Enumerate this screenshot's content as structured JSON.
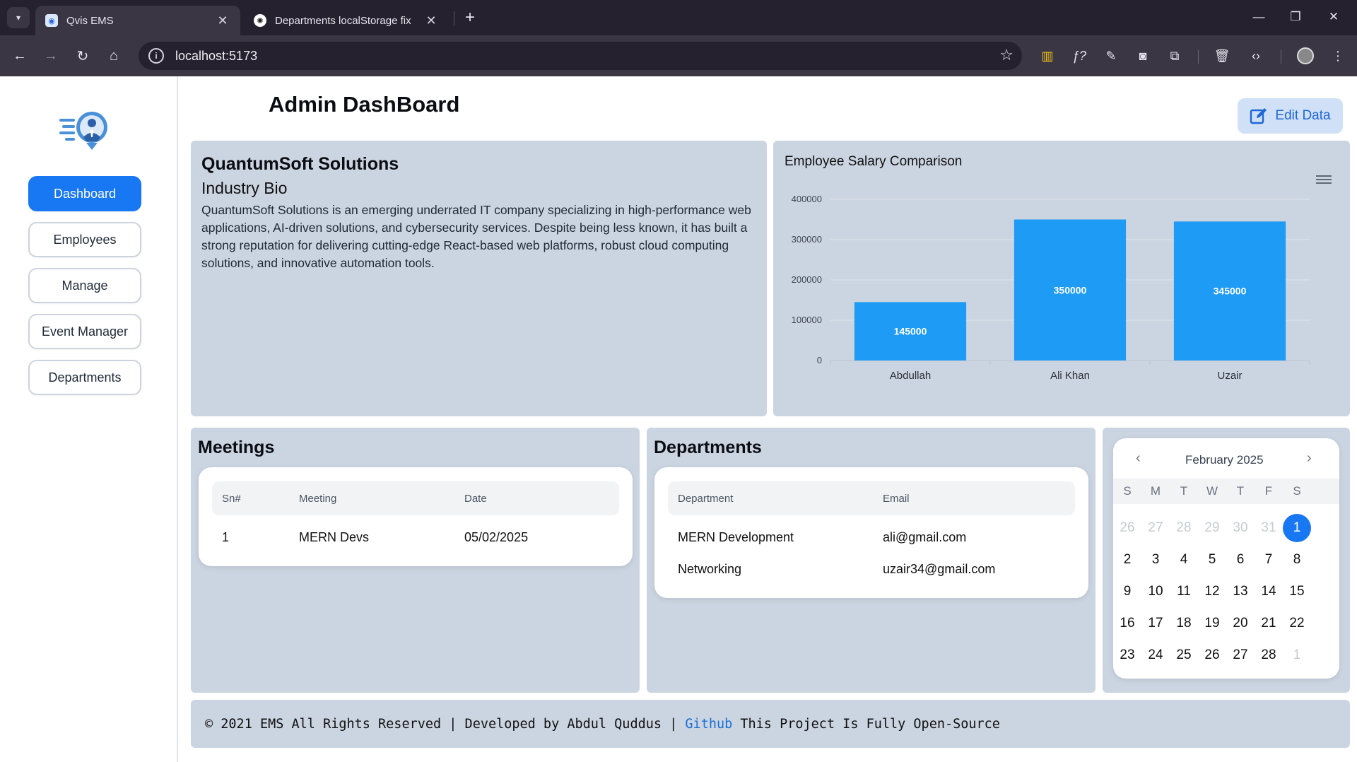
{
  "browser": {
    "tabs": [
      {
        "title": "Qvis EMS",
        "active": true
      },
      {
        "title": "Departments localStorage fix",
        "active": false
      }
    ],
    "url": "localhost:5173"
  },
  "sidebar": {
    "items": [
      {
        "label": "Dashboard",
        "active": true
      },
      {
        "label": "Employees"
      },
      {
        "label": "Manage"
      },
      {
        "label": "Event Manager"
      },
      {
        "label": "Departments"
      }
    ]
  },
  "header": {
    "title": "Admin DashBoard",
    "edit_label": "Edit Data"
  },
  "company": {
    "name": "QuantumSoft Solutions",
    "bio_title": "Industry Bio",
    "bio_text": "QuantumSoft Solutions is an emerging underrated IT company specializing in high-performance web applications, AI-driven solutions, and cybersecurity services. Despite being less known, it has built a strong reputation for delivering cutting-edge React-based web platforms, robust cloud computing solutions, and innovative automation tools."
  },
  "chart_data": {
    "type": "bar",
    "title": "Employee Salary Comparison",
    "categories": [
      "Abdullah",
      "Ali Khan",
      "Uzair"
    ],
    "values": [
      145000,
      350000,
      345000
    ],
    "yticks": [
      "0",
      "100000",
      "200000",
      "300000",
      "400000"
    ],
    "ylim": [
      0,
      400000
    ],
    "bar_color": "#1e9bf5",
    "grid": true
  },
  "meetings": {
    "title": "Meetings",
    "columns": [
      "Sn#",
      "Meeting",
      "Date"
    ],
    "rows": [
      [
        "1",
        "MERN Devs",
        "05/02/2025"
      ]
    ]
  },
  "departments": {
    "title": "Departments",
    "columns": [
      "Department",
      "Email"
    ],
    "rows": [
      [
        "MERN Development",
        "ali@gmail.com"
      ],
      [
        "Networking",
        "uzair34@gmail.com"
      ]
    ]
  },
  "calendar": {
    "month_label": "February 2025",
    "dow": [
      "S",
      "M",
      "T",
      "W",
      "T",
      "F",
      "S"
    ],
    "weeks": [
      [
        "26",
        "27",
        "28",
        "29",
        "30",
        "31",
        "1"
      ],
      [
        "2",
        "3",
        "4",
        "5",
        "6",
        "7",
        "8"
      ],
      [
        "9",
        "10",
        "11",
        "12",
        "13",
        "14",
        "15"
      ],
      [
        "16",
        "17",
        "18",
        "19",
        "20",
        "21",
        "22"
      ],
      [
        "23",
        "24",
        "25",
        "26",
        "27",
        "28",
        "1"
      ]
    ],
    "selected": "1"
  },
  "footer": {
    "left": "© 2021 EMS All Rights Reserved | Developed by Abdul Quddus | ",
    "link": "Github",
    "right": " This Project Is Fully Open-Source"
  },
  "colors": {
    "accent": "#1877f2",
    "panel": "#cbd5e1"
  }
}
